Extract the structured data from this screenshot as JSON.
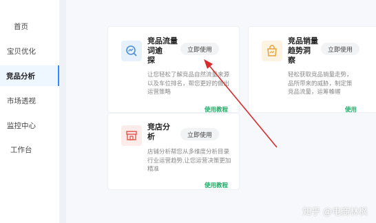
{
  "sidebar": {
    "items": [
      {
        "label": "首页"
      },
      {
        "label": "宝贝优化"
      },
      {
        "label": "竞品分析"
      },
      {
        "label": "市场透视"
      },
      {
        "label": "监控中心"
      },
      {
        "label": "工作台"
      }
    ],
    "active_index": 2
  },
  "cards": [
    {
      "title_lines": [
        "竞品流量",
        "词逾",
        "探"
      ],
      "button": "立即使用",
      "desc_lines": [
        "让您轻松了解竞品自然流量来源",
        "以及车位排名，帮您更好的做出",
        "运营策略"
      ],
      "tutorial": "使用教程",
      "icon": "traffic-search-icon"
    },
    {
      "title_lines": [
        "竞品销量",
        "趋势洞",
        "察"
      ],
      "button": "立即使用",
      "desc_lines": [
        "轻松获取竞品销量走势，",
        "品所带来的威胁，制定策",
        "竞品流量，运筹帷幄"
      ],
      "tutorial": "使用",
      "icon": "sales-bag-icon"
    },
    {
      "title_lines": [
        "竞店分",
        "析"
      ],
      "button": "立即使用",
      "desc_lines": [
        "店铺分析帮您从多维度分析目录",
        "行业运营趋势,让您运营决策更加",
        "精准"
      ],
      "tutorial": "使用教程",
      "icon": "store-icon"
    }
  ],
  "watermark": "知乎 @电商林枫",
  "colors": {
    "active_bar": "#2c8cff",
    "tutorial": "#2aa96a",
    "arrow": "#d62b2b"
  }
}
